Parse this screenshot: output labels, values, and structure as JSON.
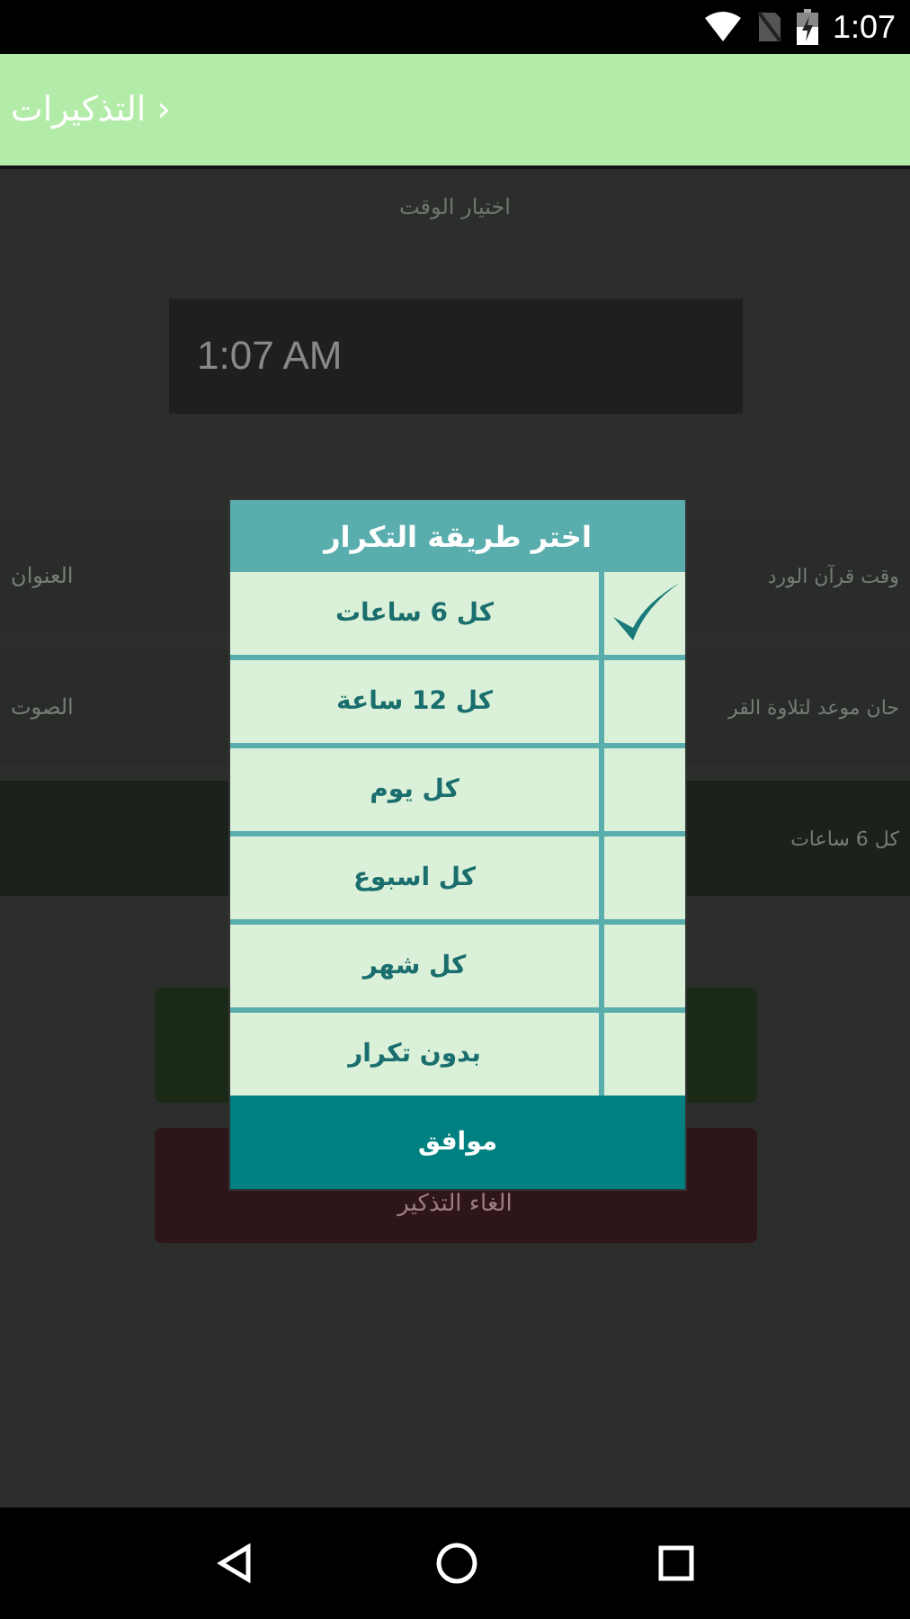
{
  "status_bar": {
    "time": "1:07"
  },
  "app_bar": {
    "title": "التذكيرات",
    "back_glyph": "›"
  },
  "time_section": {
    "label": "اختيار الوقت",
    "value": "1:07 AM"
  },
  "settings": [
    {
      "label": "العنوان",
      "value": "وقت قرآن الورد",
      "highlighted": false
    },
    {
      "label": "الصوت",
      "value": "حان موعد لتلاوة القر",
      "highlighted": false
    },
    {
      "value": "كل 6 ساعات",
      "highlighted": true
    }
  ],
  "cancel_button": "الغاء التذكير",
  "dialog": {
    "title": "اختر طريقة التكرار",
    "options": [
      {
        "label": "كل 6 ساعات",
        "selected": true
      },
      {
        "label": "كل 12 ساعة",
        "selected": false
      },
      {
        "label": "كل يوم",
        "selected": false
      },
      {
        "label": "كل اسبوع",
        "selected": false
      },
      {
        "label": "كل شهر",
        "selected": false
      },
      {
        "label": "بدون تكرار",
        "selected": false
      }
    ],
    "ok": "موافق"
  }
}
